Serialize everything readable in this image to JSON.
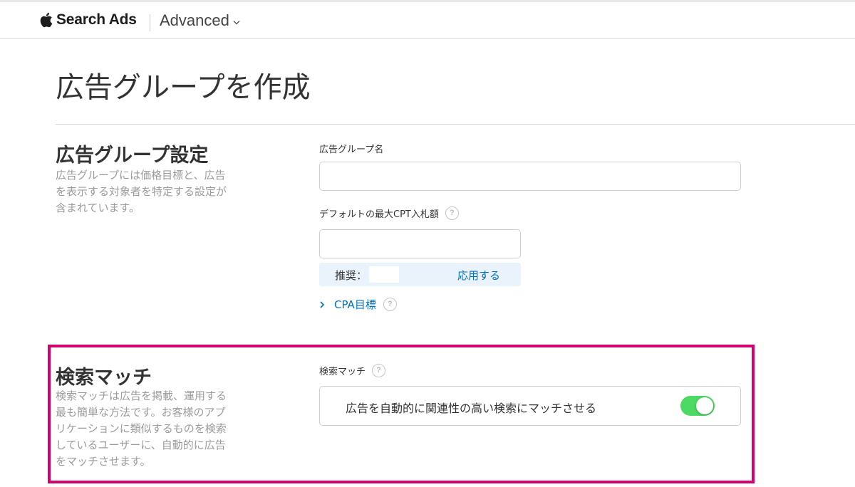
{
  "header": {
    "brand": "Search Ads",
    "mode": "Advanced"
  },
  "page": {
    "title": "広告グループを作成"
  },
  "ad_group_settings": {
    "title": "広告グループ設定",
    "description": "広告グループには価格目標と、広告を表示する対象者を特定する設定が含まれています。",
    "name_label": "広告グループ名",
    "name_value": "",
    "default_bid_label": "デフォルトの最大CPT入札額",
    "default_bid_value": "",
    "recommend_label": "推奨：",
    "recommend_apply": "応用する",
    "cpa_label": "CPA目標"
  },
  "search_match": {
    "title": "検索マッチ",
    "description": "検索マッチは広告を掲載、運用する最も簡単な方法です。お客様のアプリケーションに類似するものを検索しているユーザーに、自動的に広告をマッチさせます。",
    "field_label": "検索マッチ",
    "toggle_label": "広告を自動的に関連性の高い検索にマッチさせる",
    "toggle_on": true
  },
  "colors": {
    "accent": "#0070c9",
    "toggle_on": "#4cd964",
    "highlight": "#d4006e"
  }
}
